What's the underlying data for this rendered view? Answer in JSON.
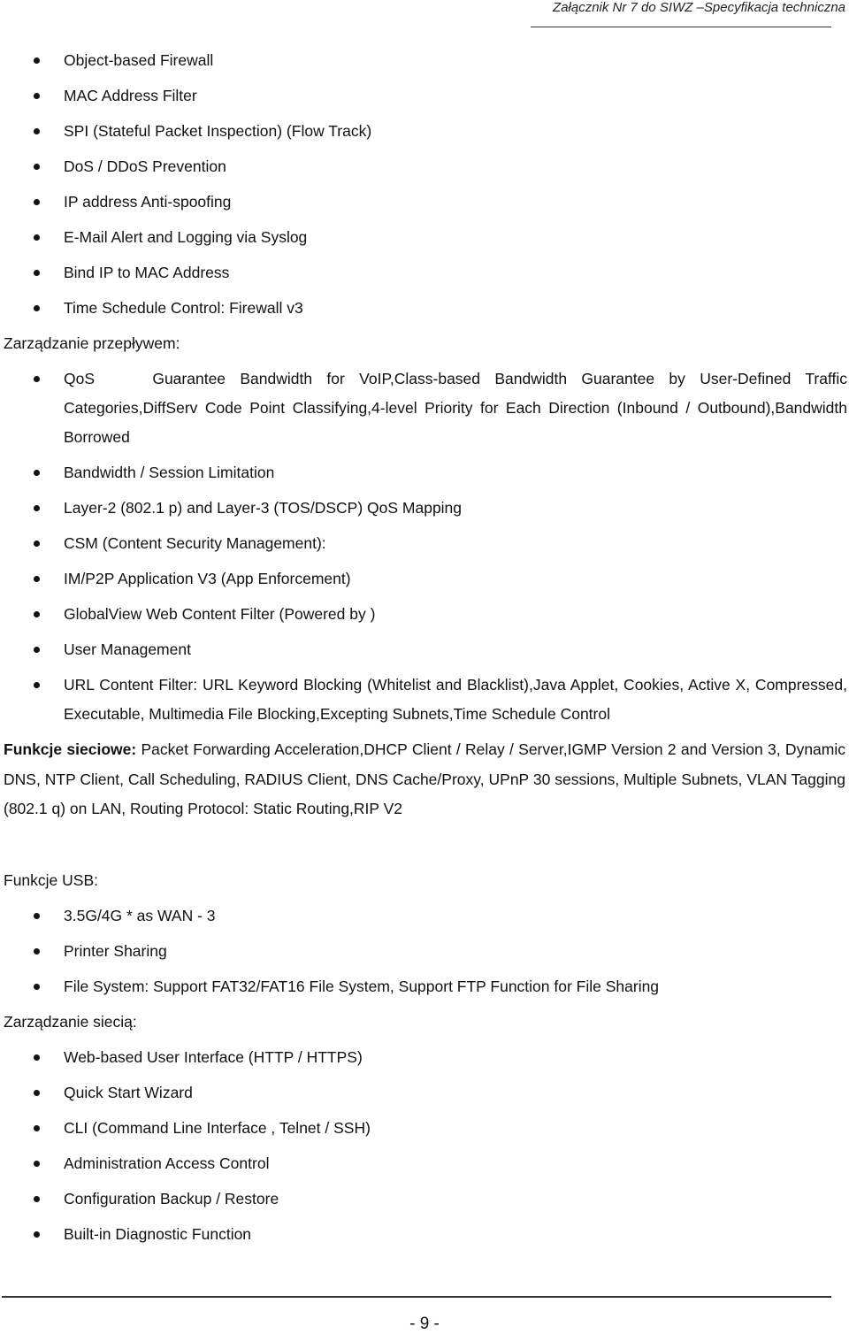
{
  "header": {
    "title": "Załącznik Nr 7 do SIWZ –Specyfikacja techniczna"
  },
  "firewall_items": [
    "Object-based Firewall",
    "MAC Address Filter",
    "SPI (Stateful Packet Inspection) (Flow Track)",
    "DoS / DDoS Prevention",
    "IP address Anti-spoofing",
    "E-Mail Alert and Logging via Syslog",
    "Bind IP to MAC Address",
    "Time Schedule Control: Firewall v3"
  ],
  "traffic": {
    "label": "Zarządzanie przepływem:",
    "items": [
      "QoS    Guarantee Bandwidth for VoIP,Class-based Bandwidth Guarantee by User-Defined Traffic Categories,DiffServ Code Point Classifying,4-level Priority for Each Direction (Inbound / Outbound),Bandwidth Borrowed",
      "Bandwidth / Session Limitation",
      "Layer-2 (802.1 p) and Layer-3 (TOS/DSCP) QoS Mapping",
      "CSM (Content Security Management):",
      "IM/P2P Application V3 (App Enforcement)",
      "GlobalView Web Content Filter (Powered by )",
      "User Management",
      "URL Content Filter: URL Keyword Blocking (Whitelist and Blacklist),Java Applet, Cookies, Active X, Compressed, Executable, Multimedia File Blocking,Excepting Subnets,Time Schedule Control"
    ]
  },
  "network": {
    "label": "Funkcje sieciowe:",
    "text": " Packet Forwarding Acceleration,DHCP Client / Relay / Server,IGMP Version 2 and Version 3, Dynamic DNS, NTP Client, Call Scheduling, RADIUS Client, DNS Cache/Proxy, UPnP 30 sessions, Multiple Subnets, VLAN Tagging (802.1 q) on LAN, Routing Protocol: Static Routing,RIP V2"
  },
  "usb": {
    "label": "Funkcje USB:",
    "items": [
      "3.5G/4G * as WAN - 3",
      "Printer Sharing",
      "File System: Support FAT32/FAT16 File System, Support FTP Function for File Sharing"
    ]
  },
  "management": {
    "label": "Zarządzanie siecią:",
    "items": [
      "Web-based User Interface (HTTP / HTTPS)",
      "Quick Start Wizard",
      "CLI (Command Line Interface , Telnet / SSH)",
      "Administration Access Control",
      "Configuration Backup / Restore",
      "Built-in Diagnostic Function"
    ]
  },
  "footer": {
    "page_number": "- 9 -"
  }
}
